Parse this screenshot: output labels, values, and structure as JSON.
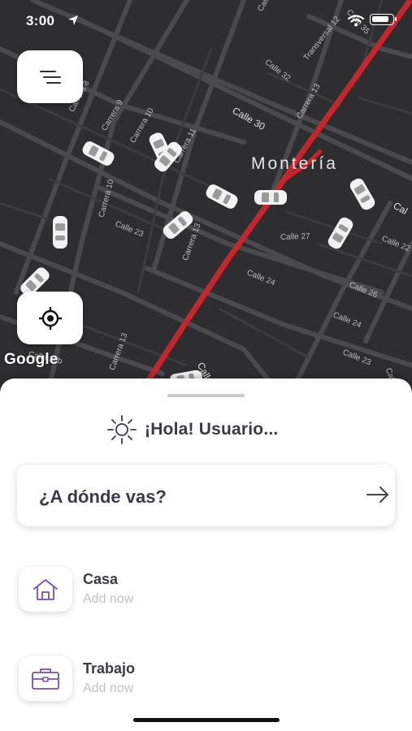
{
  "status_bar": {
    "time": "3:00",
    "battery_level": 0.85
  },
  "map": {
    "city_label": "Montería",
    "attribution": "Google",
    "streets": [
      "Calle 32",
      "Calle 30",
      "Calle 23",
      "Calle 27",
      "Calle 24",
      "Calle 26",
      "Calle 23",
      "Calle 22",
      "Calle 16b",
      "Calle",
      "Carrera 8",
      "Carrera 9",
      "Carrera 10",
      "Carrera 11",
      "Carrera 10",
      "Carrera 13",
      "Carrera 13",
      "Carrera 13",
      "Transversal 12",
      "Calle 35",
      "Calle 22c",
      "Calle",
      "Calle 24",
      "Cal"
    ],
    "colors": {
      "route": "#c4262c",
      "background": "#2e2e30"
    }
  },
  "buttons": {
    "menu_icon": "menu-lines-icon",
    "locate_icon": "locate-target-icon"
  },
  "sheet": {
    "greeting": "¡Hola! Usuario...",
    "search_label": "¿A dónde vas?",
    "places": [
      {
        "title": "Casa",
        "subtitle": "Add now",
        "icon": "home-icon"
      },
      {
        "title": "Trabajo",
        "subtitle": "Add now",
        "icon": "briefcase-icon"
      }
    ],
    "accent_color": "#7a4fb0"
  }
}
